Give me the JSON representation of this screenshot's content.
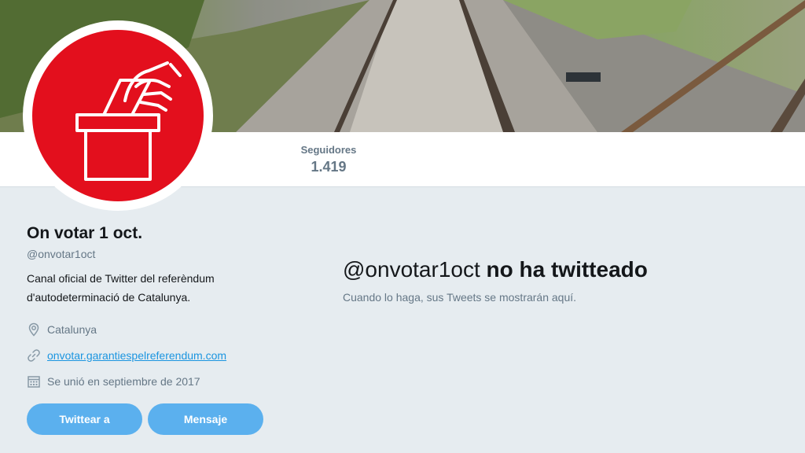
{
  "profile": {
    "display_name": "On votar 1 oct.",
    "handle": "@onvotar1oct",
    "bio_line1": "Canal oficial de Twitter del referèndum",
    "bio_line2": "d'autodeterminació de Catalunya.",
    "location": "Catalunya",
    "website": "onvotar.garantiespelreferendum.com",
    "joined": "Se unió en septiembre de 2017"
  },
  "stats": {
    "followers_label": "Seguidores",
    "followers_value": "1.419"
  },
  "actions": {
    "tweet_to": "Twittear a",
    "message": "Mensaje"
  },
  "empty_state": {
    "title_handle": "@onvotar1oct",
    "title_rest": "no ha twitteado",
    "subtitle": "Cuando lo haga, sus Tweets se mostrarán aquí."
  },
  "colors": {
    "accent": "#1b95e0",
    "button": "#5bb0ee",
    "avatar_red": "#e30f1d"
  },
  "icons": {
    "location": "location-pin-icon",
    "link": "link-icon",
    "calendar": "calendar-icon"
  }
}
